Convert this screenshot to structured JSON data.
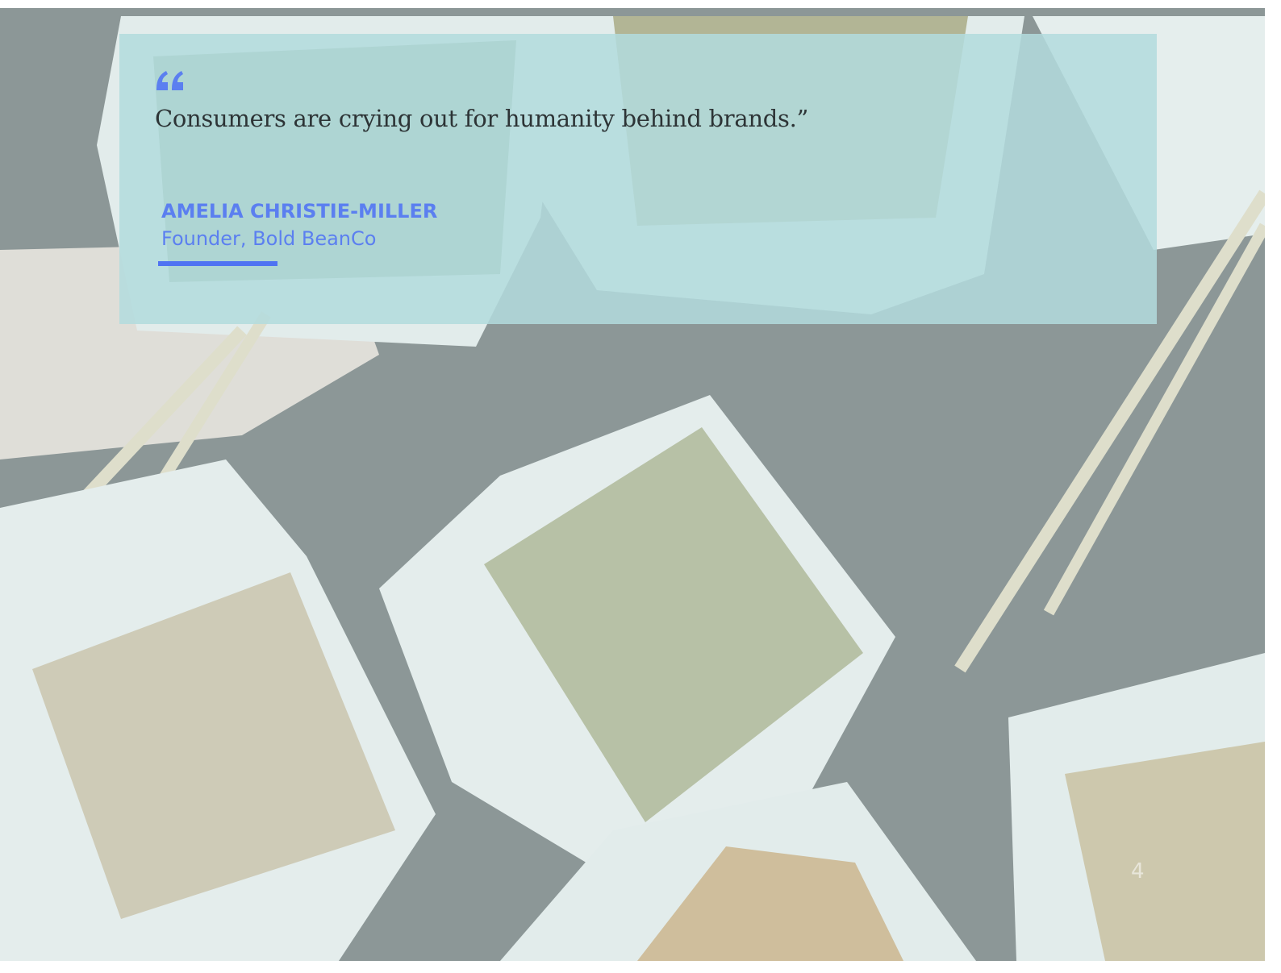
{
  "quote": {
    "mark_icon": "quote-open-icon",
    "text": "Consumers are crying out for humanity behind brands.”"
  },
  "author": {
    "name": "AMELIA CHRISTIE-MILLER",
    "role": "Founder, Bold BeanCo"
  },
  "slide": {
    "page_number": "4"
  },
  "colors": {
    "accent": "#5b7ff0",
    "card": "#b2dbdd",
    "quote_text": "#2d3436"
  },
  "background": {
    "image": "takeout-boxes-photo"
  }
}
